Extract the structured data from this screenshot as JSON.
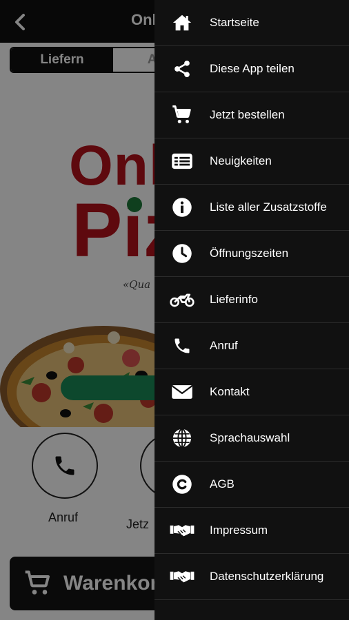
{
  "app": {
    "title": "Onl",
    "tabs": [
      {
        "label": "Liefern",
        "active": true
      },
      {
        "label": "Abho",
        "active": false
      }
    ],
    "logo": {
      "line1": "Onl",
      "line2": "Piz"
    },
    "slogan": "«Qua",
    "quick_actions": [
      {
        "label": "Anruf",
        "icon": "phone-icon"
      },
      {
        "label": "Jetz",
        "icon": "cart-icon"
      }
    ],
    "cart": {
      "label": "Warenkorl",
      "icon": "cart-icon"
    }
  },
  "colors": {
    "brand_red": "#b5121b",
    "brand_green": "#1a8a56",
    "drawer_bg": "#111111"
  },
  "drawer": {
    "items": [
      {
        "label": "Startseite",
        "icon": "home-icon"
      },
      {
        "label": "Diese App teilen",
        "icon": "share-icon"
      },
      {
        "label": "Jetzt bestellen",
        "icon": "cart-icon"
      },
      {
        "label": "Neuigkeiten",
        "icon": "news-icon"
      },
      {
        "label": "Liste aller Zusatzstoffe",
        "icon": "info-icon"
      },
      {
        "label": "Öffnungszeiten",
        "icon": "clock-icon"
      },
      {
        "label": "Lieferinfo",
        "icon": "motorbike-icon"
      },
      {
        "label": "Anruf",
        "icon": "phone-icon"
      },
      {
        "label": "Kontakt",
        "icon": "envelope-icon"
      },
      {
        "label": "Sprachauswahl",
        "icon": "globe-icon"
      },
      {
        "label": "AGB",
        "icon": "copyright-icon"
      },
      {
        "label": "Impressum",
        "icon": "handshake-icon"
      },
      {
        "label": "Datenschutzerklärung",
        "icon": "handshake-icon"
      }
    ]
  }
}
